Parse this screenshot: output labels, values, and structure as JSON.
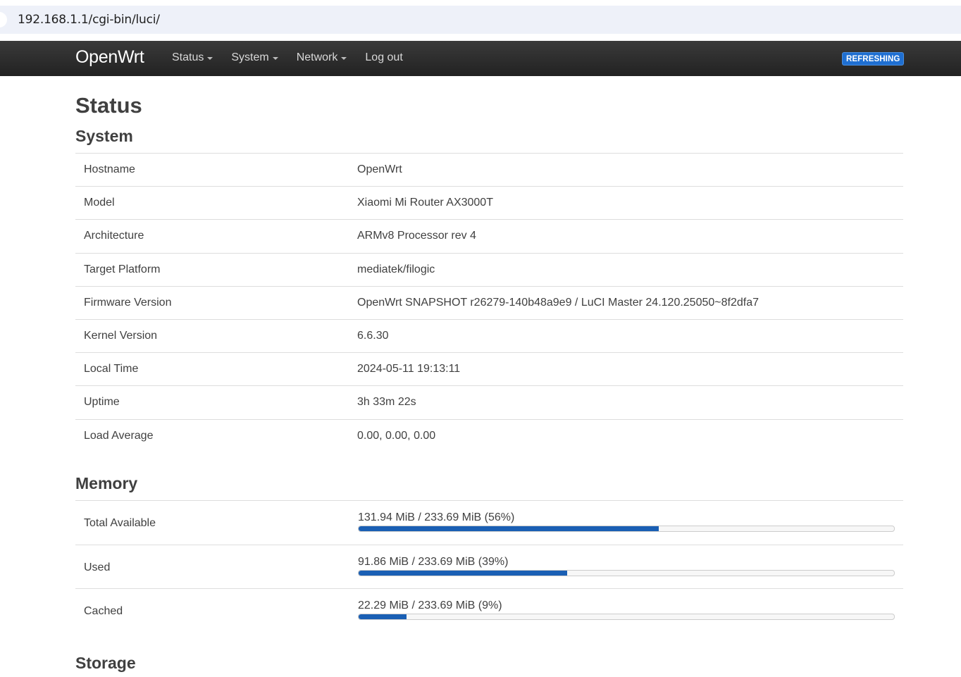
{
  "browser": {
    "url": "192.168.1.1/cgi-bin/luci/"
  },
  "navbar": {
    "brand": "OpenWrt",
    "items": [
      {
        "label": "Status",
        "dropdown": true
      },
      {
        "label": "System",
        "dropdown": true
      },
      {
        "label": "Network",
        "dropdown": true
      },
      {
        "label": "Log out",
        "dropdown": false
      }
    ],
    "badge": "REFRESHING",
    "badge_color": "#1f6fd1"
  },
  "page": {
    "title": "Status"
  },
  "system": {
    "title": "System",
    "rows": [
      {
        "key": "Hostname",
        "value": "OpenWrt"
      },
      {
        "key": "Model",
        "value": "Xiaomi Mi Router AX3000T"
      },
      {
        "key": "Architecture",
        "value": "ARMv8 Processor rev 4"
      },
      {
        "key": "Target Platform",
        "value": "mediatek/filogic"
      },
      {
        "key": "Firmware Version",
        "value": "OpenWrt SNAPSHOT r26279-140b48a9e9 / LuCI Master 24.120.25050~8f2dfa7"
      },
      {
        "key": "Kernel Version",
        "value": "6.6.30"
      },
      {
        "key": "Local Time",
        "value": "2024-05-11 19:13:11"
      },
      {
        "key": "Uptime",
        "value": "3h 33m 22s"
      },
      {
        "key": "Load Average",
        "value": "0.00, 0.00, 0.00"
      }
    ]
  },
  "memory": {
    "title": "Memory",
    "bar_color": "#1a5fb4",
    "rows": [
      {
        "key": "Total Available",
        "text": "131.94 MiB / 233.69 MiB (56%)",
        "fraction": 0.56
      },
      {
        "key": "Used",
        "text": "91.86 MiB / 233.69 MiB (39%)",
        "fraction": 0.39
      },
      {
        "key": "Cached",
        "text": "22.29 MiB / 233.69 MiB (9%)",
        "fraction": 0.09
      }
    ]
  },
  "storage": {
    "title": "Storage"
  }
}
